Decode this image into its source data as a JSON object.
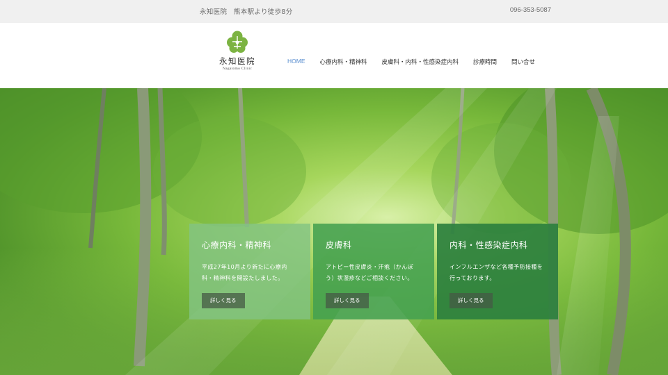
{
  "topbar": {
    "clinic_info": "永知医院　熊本駅より徒歩8分",
    "phone": "096-353-5087"
  },
  "logo": {
    "name": "永知医院",
    "subtitle": "Nagatomo Clinic"
  },
  "nav": {
    "items": [
      {
        "label": "HOME",
        "active": true
      },
      {
        "label": "心療内科・精神科",
        "active": false
      },
      {
        "label": "皮膚科・内科・性感染症内科",
        "active": false
      },
      {
        "label": "診療時間",
        "active": false
      },
      {
        "label": "問い合せ",
        "active": false
      }
    ]
  },
  "cards": [
    {
      "title": "心療内科・精神科",
      "text": "平成27年10月より新たに心療内科・精神科を開設たしました。",
      "button": "詳しく見る"
    },
    {
      "title": "皮膚科",
      "text": "アトピー性皮膚炎・汗疱（かんぽう）状湿疹などご相談ください。",
      "button": "詳しく見る"
    },
    {
      "title": "内科・性感染症内科",
      "text": "インフルエンザなど各種予防接種を行っております。",
      "button": "詳しく見る"
    }
  ],
  "colors": {
    "accent": "#5b8fd0",
    "logo_green": "#7cb342",
    "card_light": "#82c382",
    "card_mid": "#44a050",
    "card_dark": "#2c803e"
  }
}
